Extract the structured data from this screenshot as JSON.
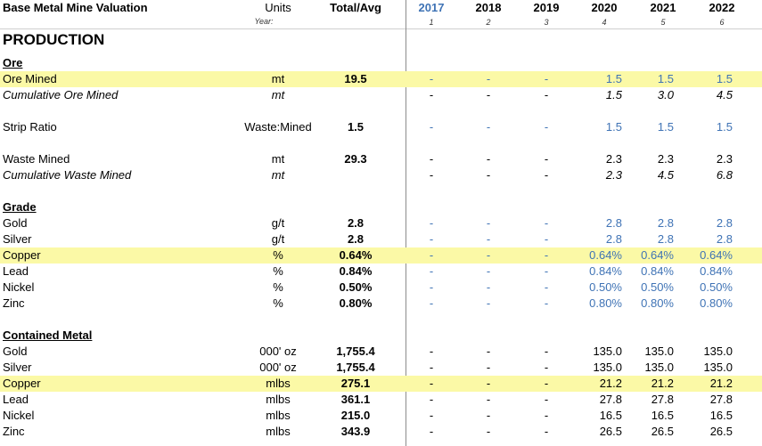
{
  "header": {
    "title": "Base Metal Mine Valuation",
    "units_label": "Units",
    "year_label": "Year:",
    "total_label": "Total/Avg",
    "years": [
      {
        "label": "2017",
        "num": "1",
        "color": "#3f73b5"
      },
      {
        "label": "2018",
        "num": "2",
        "color": "#000000"
      },
      {
        "label": "2019",
        "num": "3",
        "color": "#000000"
      },
      {
        "label": "2020",
        "num": "4",
        "color": "#000000"
      },
      {
        "label": "2021",
        "num": "5",
        "color": "#000000"
      },
      {
        "label": "2022",
        "num": "6",
        "color": "#000000"
      }
    ]
  },
  "section_title": "PRODUCTION",
  "colors": {
    "highlight": "#fbf9a6",
    "input_blue": "#3f73b5",
    "divider": "#8c8c8c"
  },
  "rows": [
    {
      "type": "section",
      "label": "Ore"
    },
    {
      "type": "data",
      "highlight": true,
      "blue": true,
      "label": "Ore Mined",
      "units": "mt",
      "total": "19.5",
      "values": [
        "-",
        "-",
        "-",
        "1.5",
        "1.5",
        "1.5"
      ]
    },
    {
      "type": "data",
      "italic": true,
      "label": "Cumulative Ore Mined",
      "units": "mt",
      "total": "",
      "values": [
        "-",
        "-",
        "-",
        "1.5",
        "3.0",
        "4.5"
      ]
    },
    {
      "type": "spacer"
    },
    {
      "type": "data",
      "blue": true,
      "label": "Strip Ratio",
      "units": "Waste:Mined",
      "total": "1.5",
      "values": [
        "-",
        "-",
        "-",
        "1.5",
        "1.5",
        "1.5"
      ]
    },
    {
      "type": "spacer"
    },
    {
      "type": "data",
      "label": "Waste Mined",
      "units": "mt",
      "total": "29.3",
      "values": [
        "-",
        "-",
        "-",
        "2.3",
        "2.3",
        "2.3"
      ]
    },
    {
      "type": "data",
      "italic": true,
      "label": "Cumulative Waste Mined",
      "units": "mt",
      "total": "",
      "values": [
        "-",
        "-",
        "-",
        "2.3",
        "4.5",
        "6.8"
      ]
    },
    {
      "type": "spacer"
    },
    {
      "type": "section",
      "label": "Grade"
    },
    {
      "type": "data",
      "blue": true,
      "label": "Gold",
      "units": "g/t",
      "total": "2.8",
      "values": [
        "-",
        "-",
        "-",
        "2.8",
        "2.8",
        "2.8"
      ]
    },
    {
      "type": "data",
      "blue": true,
      "label": "Silver",
      "units": "g/t",
      "total": "2.8",
      "values": [
        "-",
        "-",
        "-",
        "2.8",
        "2.8",
        "2.8"
      ]
    },
    {
      "type": "data",
      "highlight": true,
      "blue": true,
      "label": "Copper",
      "units": "%",
      "total": "0.64%",
      "values": [
        "-",
        "-",
        "-",
        "0.64%",
        "0.64%",
        "0.64%"
      ]
    },
    {
      "type": "data",
      "blue": true,
      "label": "Lead",
      "units": "%",
      "total": "0.84%",
      "values": [
        "-",
        "-",
        "-",
        "0.84%",
        "0.84%",
        "0.84%"
      ]
    },
    {
      "type": "data",
      "blue": true,
      "label": "Nickel",
      "units": "%",
      "total": "0.50%",
      "values": [
        "-",
        "-",
        "-",
        "0.50%",
        "0.50%",
        "0.50%"
      ]
    },
    {
      "type": "data",
      "blue": true,
      "label": "Zinc",
      "units": "%",
      "total": "0.80%",
      "values": [
        "-",
        "-",
        "-",
        "0.80%",
        "0.80%",
        "0.80%"
      ]
    },
    {
      "type": "spacer"
    },
    {
      "type": "section",
      "label": "Contained Metal"
    },
    {
      "type": "data",
      "label": "Gold",
      "units": "000' oz",
      "total": "1,755.4",
      "values": [
        "-",
        "-",
        "-",
        "135.0",
        "135.0",
        "135.0"
      ]
    },
    {
      "type": "data",
      "label": "Silver",
      "units": "000' oz",
      "total": "1,755.4",
      "values": [
        "-",
        "-",
        "-",
        "135.0",
        "135.0",
        "135.0"
      ]
    },
    {
      "type": "data",
      "highlight": true,
      "label": "Copper",
      "units": "mlbs",
      "total": "275.1",
      "values": [
        "-",
        "-",
        "-",
        "21.2",
        "21.2",
        "21.2"
      ]
    },
    {
      "type": "data",
      "label": "Lead",
      "units": "mlbs",
      "total": "361.1",
      "values": [
        "-",
        "-",
        "-",
        "27.8",
        "27.8",
        "27.8"
      ]
    },
    {
      "type": "data",
      "label": "Nickel",
      "units": "mlbs",
      "total": "215.0",
      "values": [
        "-",
        "-",
        "-",
        "16.5",
        "16.5",
        "16.5"
      ]
    },
    {
      "type": "data",
      "label": "Zinc",
      "units": "mlbs",
      "total": "343.9",
      "values": [
        "-",
        "-",
        "-",
        "26.5",
        "26.5",
        "26.5"
      ]
    }
  ]
}
